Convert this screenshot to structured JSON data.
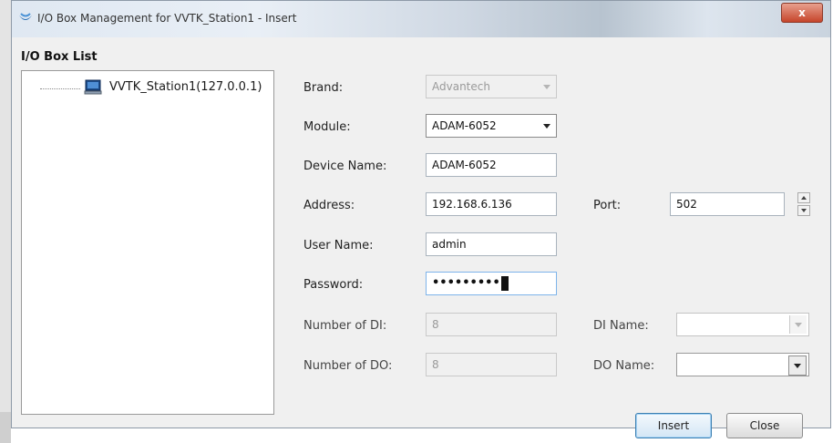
{
  "window": {
    "title": "I/O Box Management for VVTK_Station1 - Insert",
    "close_label": "x"
  },
  "left_panel": {
    "title": "I/O Box List",
    "tree_items": [
      {
        "label": "VVTK_Station1(127.0.0.1)",
        "icon": "computer-icon"
      }
    ]
  },
  "form": {
    "brand": {
      "label": "Brand:",
      "value": "Advantech"
    },
    "module": {
      "label": "Module:",
      "value": "ADAM-6052"
    },
    "device_name": {
      "label": "Device Name:",
      "value": "ADAM-6052"
    },
    "address": {
      "label": "Address:",
      "value": "192.168.6.136"
    },
    "port": {
      "label": "Port:",
      "value": "502"
    },
    "user_name": {
      "label": "User Name:",
      "value": "admin"
    },
    "password": {
      "label": "Password:",
      "value": "•••••••••"
    },
    "number_of_di": {
      "label": "Number of DI:",
      "value": "8"
    },
    "di_name": {
      "label": "DI Name:",
      "value": ""
    },
    "number_of_do": {
      "label": "Number of DO:",
      "value": "8"
    },
    "do_name": {
      "label": "DO Name:",
      "value": ""
    }
  },
  "buttons": {
    "insert": "Insert",
    "close": "Close"
  }
}
